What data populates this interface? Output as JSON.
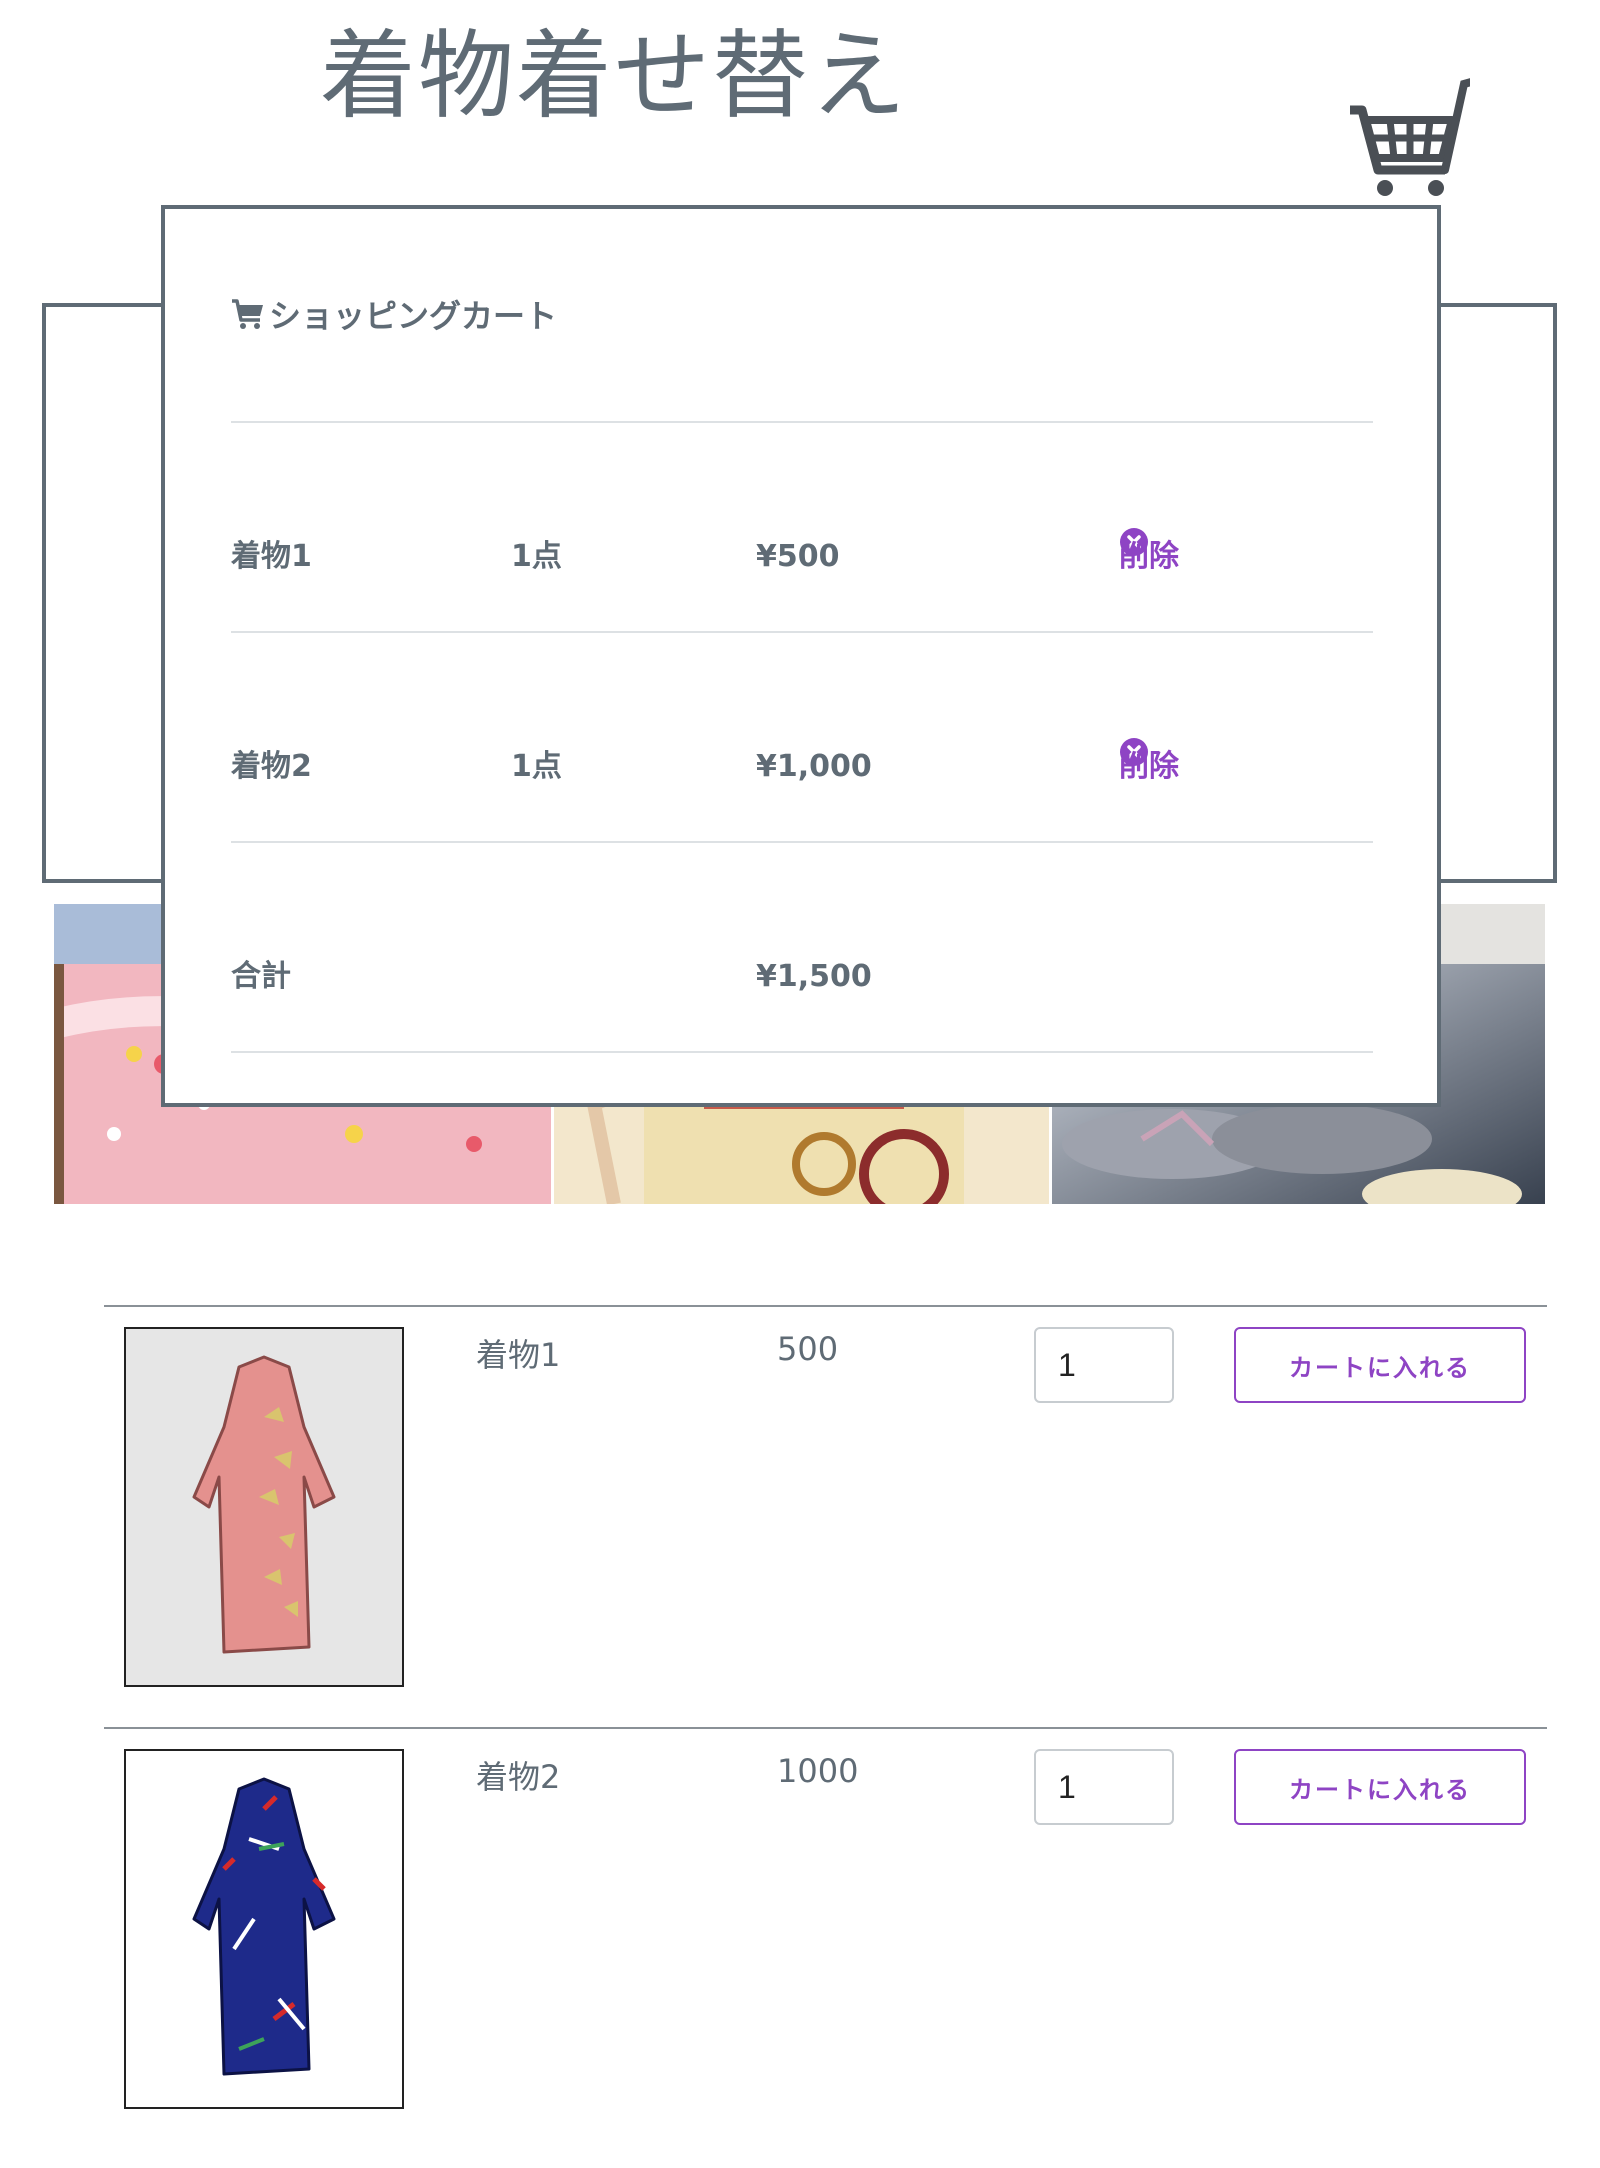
{
  "site": {
    "title": "着物着せ替え"
  },
  "icons": {
    "header_cart": "shopping-cart-icon",
    "modal_cart": "cart-icon",
    "delete": "times-circle-icon"
  },
  "colors": {
    "text": "#5f6b75",
    "accent": "#8e44c4",
    "border": "#5f6b75"
  },
  "cart_modal": {
    "heading": "ショッピングカート",
    "items": [
      {
        "name": "着物1",
        "qty": "1点",
        "price": "¥500",
        "remove_label": "削除"
      },
      {
        "name": "着物2",
        "qty": "1点",
        "price": "¥1,000",
        "remove_label": "削除"
      }
    ],
    "total": {
      "label": "合計",
      "price": "¥1,500"
    }
  },
  "products": [
    {
      "name": "着物1",
      "price": "500",
      "quantity": "1",
      "add_label": "カートに入れる"
    },
    {
      "name": "着物2",
      "price": "1000",
      "quantity": "1",
      "add_label": "カートに入れる"
    }
  ]
}
